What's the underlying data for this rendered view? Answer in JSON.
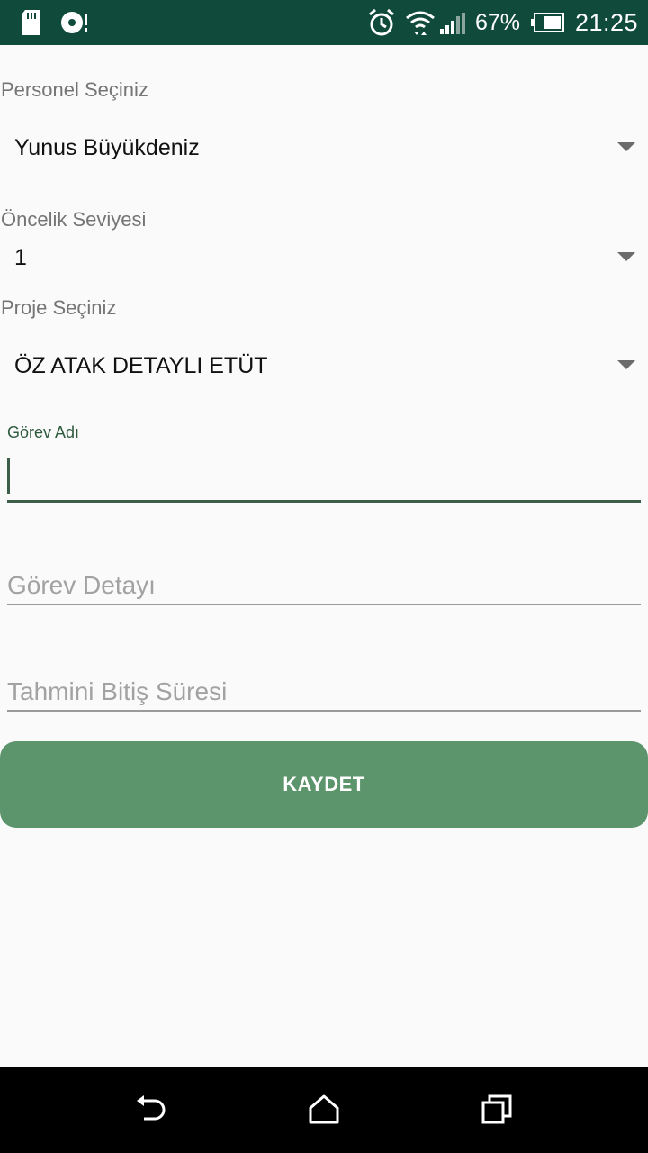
{
  "status_bar": {
    "battery_percent": "67%",
    "time": "21:25",
    "icons": [
      "sd-card-icon",
      "sync-icon",
      "alarm-icon",
      "wifi-icon",
      "signal-icon",
      "battery-icon"
    ]
  },
  "form": {
    "personnel": {
      "label": "Personel Seçiniz",
      "value": "Yunus Büyükdeniz"
    },
    "priority": {
      "label": "Öncelik Seviyesi",
      "value": "1"
    },
    "project": {
      "label": "Proje Seçiniz",
      "value": "ÖZ ATAK DETAYLI ETÜT"
    },
    "task_name": {
      "label": "Görev Adı",
      "value": ""
    },
    "task_detail": {
      "placeholder": "Görev Detayı"
    },
    "estimated_end": {
      "placeholder": "Tahmini Bitiş Süresi"
    },
    "save_label": "KAYDET"
  },
  "nav_bar": {
    "icons": [
      "back-icon",
      "home-icon",
      "recents-icon"
    ]
  },
  "colors": {
    "status_bar": "#0f4a3a",
    "accent": "#3d5e48",
    "button": "#5c946b",
    "background": "#fafafa"
  }
}
